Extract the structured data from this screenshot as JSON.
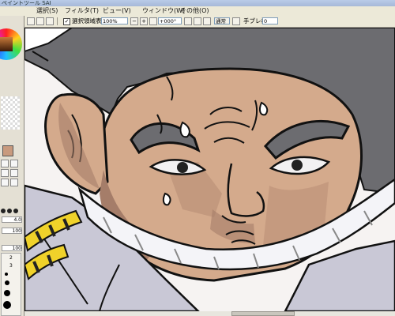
{
  "window": {
    "title": "ペイントツール SAI"
  },
  "menu": {
    "items": [
      "選択(S)",
      "フィルタ(T)",
      "ビュー(V)",
      "ウィンドウ(W)",
      "その他(O)"
    ]
  },
  "toolbar": {
    "show_selection_label": "選択領域表示",
    "show_selection_checked": "✓",
    "zoom_value": "100%",
    "rotation_value": "+000°",
    "blend_mode_value": "通常",
    "stabilizer_label": "手ブレ補正",
    "stabilizer_value": "0"
  },
  "sidebar": {
    "size_value": "4.0",
    "density_value": "100",
    "opacity_value": "100",
    "brush_sizes": [
      "2",
      "3"
    ]
  },
  "colors": {
    "face_skin": "#d4aa8c",
    "shadow_skin": "#a57d69",
    "hair_gray": "#6c6c70",
    "clothing_gray": "#c9c8d6",
    "rope_yellow": "#f0d22a",
    "swatch": "#c89a7e"
  }
}
